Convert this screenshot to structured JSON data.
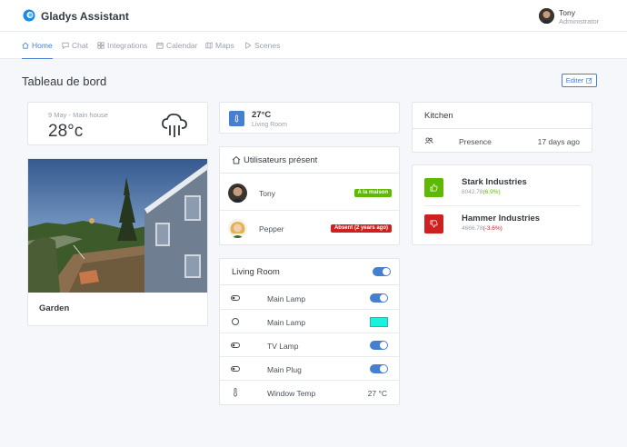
{
  "header": {
    "brand": "Gladys Assistant",
    "user_name": "Tony",
    "user_role": "Administrator"
  },
  "nav": [
    {
      "label": "Home",
      "icon": "home-icon",
      "active": true
    },
    {
      "label": "Chat",
      "icon": "chat-icon"
    },
    {
      "label": "Integrations",
      "icon": "grid-icon"
    },
    {
      "label": "Calendar",
      "icon": "calendar-icon"
    },
    {
      "label": "Maps",
      "icon": "map-icon"
    },
    {
      "label": "Scenes",
      "icon": "play-icon"
    }
  ],
  "page": {
    "title": "Tableau de bord",
    "edit_label": "Editer"
  },
  "weather": {
    "date_location": "9 May - Main house",
    "temperature": "28°c",
    "icon": "rain-cloud-icon"
  },
  "camera": {
    "label": "Garden"
  },
  "temperature_sensor": {
    "value": "27°C",
    "room": "Living Room"
  },
  "users_present": {
    "title": "Utilisateurs présent",
    "users": [
      {
        "name": "Tony",
        "status": "A la maison",
        "status_color": "#5eba00"
      },
      {
        "name": "Pepper",
        "status": "Absent (2 years ago)",
        "status_color": "#cd201f"
      }
    ]
  },
  "living_room": {
    "title": "Living Room",
    "all_on": true,
    "devices": [
      {
        "name": "Main Lamp",
        "type": "toggle",
        "on": true
      },
      {
        "name": "Main Lamp",
        "type": "color",
        "color": "#19f2de"
      },
      {
        "name": "TV Lamp",
        "type": "toggle",
        "on": true
      },
      {
        "name": "Main Plug",
        "type": "toggle",
        "on": true
      },
      {
        "name": "Window Temp",
        "type": "value",
        "value": "27 °C"
      }
    ]
  },
  "kitchen": {
    "title": "Kitchen",
    "label": "Presence",
    "time": "17 days ago"
  },
  "stocks": [
    {
      "name": "Stark Industries",
      "value": "8042.78",
      "change": "(6.9%)",
      "direction": "up",
      "color": "#5eba00"
    },
    {
      "name": "Hammer Industries",
      "value": "4666.78",
      "change": "(-3.6%)",
      "direction": "down",
      "color": "#cd201f"
    }
  ]
}
